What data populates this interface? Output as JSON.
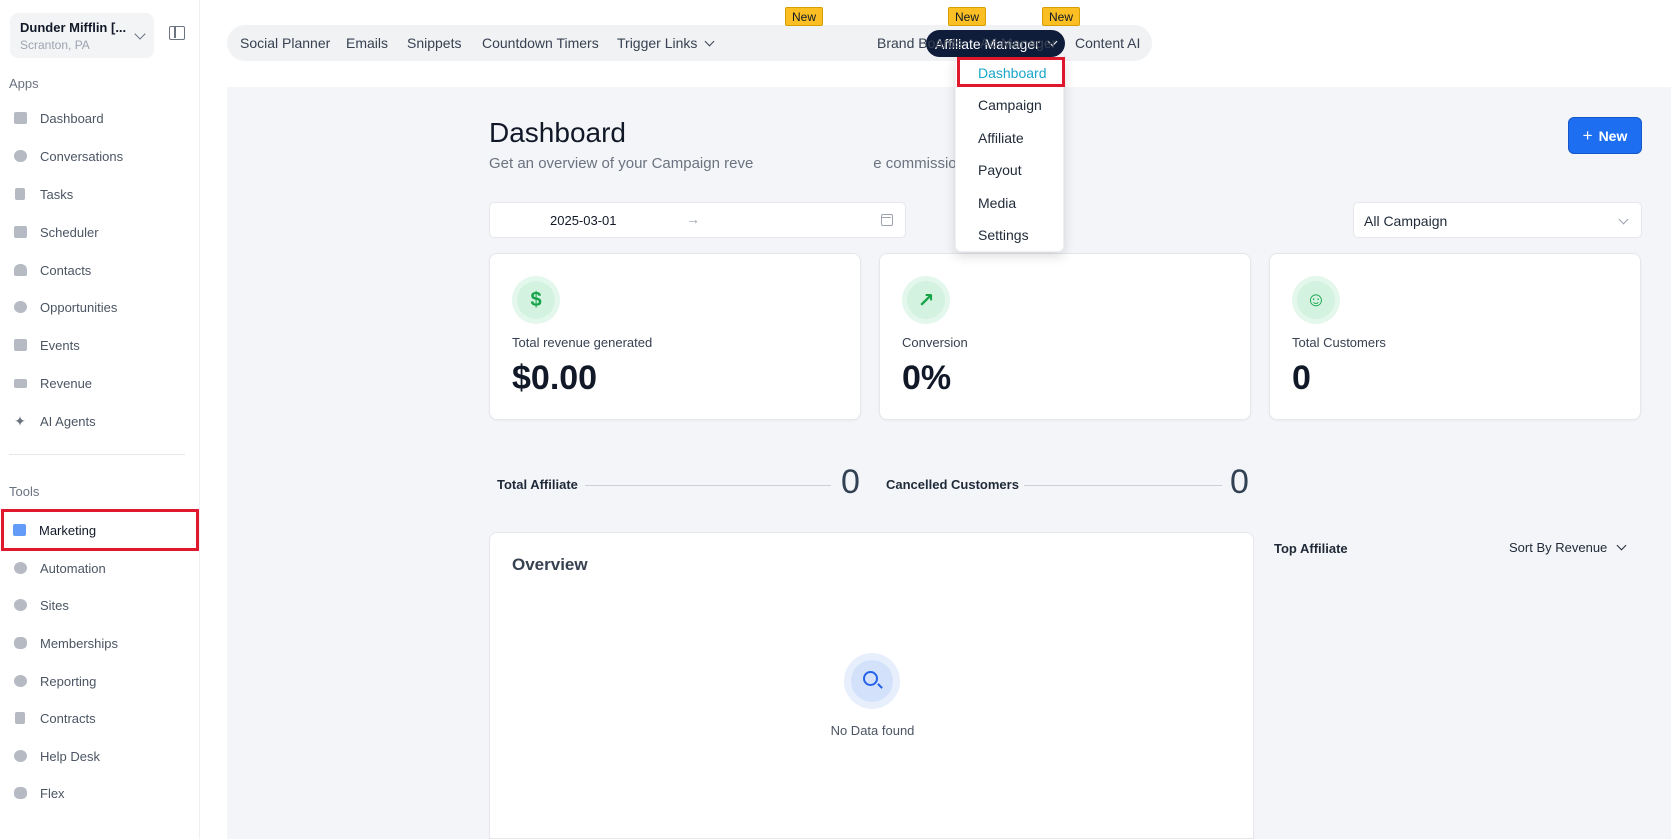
{
  "sidebar": {
    "location_name": "Dunder Mifflin [...",
    "location_sub": "Scranton, PA",
    "apps_label": "Apps",
    "tools_label": "Tools",
    "apps": [
      {
        "label": "Dashboard",
        "icon": "dashboard-icon"
      },
      {
        "label": "Conversations",
        "icon": "chat-icon"
      },
      {
        "label": "Tasks",
        "icon": "tasks-icon"
      },
      {
        "label": "Scheduler",
        "icon": "calendar-icon"
      },
      {
        "label": "Contacts",
        "icon": "person-icon"
      },
      {
        "label": "Opportunities",
        "icon": "target-icon"
      },
      {
        "label": "Events",
        "icon": "events-icon"
      },
      {
        "label": "Revenue",
        "icon": "card-icon"
      },
      {
        "label": "AI Agents",
        "icon": "sparkles-icon"
      }
    ],
    "tools": [
      {
        "label": "Marketing",
        "icon": "megaphone-icon"
      },
      {
        "label": "Automation",
        "icon": "gears-icon"
      },
      {
        "label": "Sites",
        "icon": "globe-icon"
      },
      {
        "label": "Memberships",
        "icon": "group-icon"
      },
      {
        "label": "Reporting",
        "icon": "pie-icon"
      },
      {
        "label": "Contracts",
        "icon": "document-icon"
      },
      {
        "label": "Help Desk",
        "icon": "help-icon"
      },
      {
        "label": "Flex",
        "icon": "people-icon"
      }
    ]
  },
  "topnav": {
    "tabs": [
      "Social Planner",
      "Emails",
      "Snippets",
      "Countdown Timers",
      "Trigger Links",
      "Affiliate Manager",
      "Brand Boards",
      "Ad Manager",
      "Content AI"
    ],
    "badge": "New"
  },
  "dropdown": [
    "Dashboard",
    "Campaign",
    "Affiliate",
    "Payout",
    "Media",
    "Settings"
  ],
  "page": {
    "title": "Dashboard",
    "subtitle_start": "Get an overview of your Campaign reve",
    "subtitle_end": "e commissions",
    "new_button": "New",
    "date_start": "2025-03-01",
    "campaign_select": "All Campaign"
  },
  "stats": [
    {
      "label": "Total revenue generated",
      "value": "$0.00",
      "icon_glyph": "$",
      "icon": "dollar-icon"
    },
    {
      "label": "Conversion",
      "value": "0%",
      "icon_glyph": "↗",
      "icon": "trend-up-icon"
    },
    {
      "label": "Total Customers",
      "value": "0",
      "icon_glyph": "☺",
      "icon": "customers-icon"
    }
  ],
  "metrics": [
    {
      "label": "Total Affiliate",
      "value": "0"
    },
    {
      "label": "Cancelled Customers",
      "value": "0"
    }
  ],
  "overview": {
    "title": "Overview",
    "empty": "No Data found"
  },
  "top_affiliate": {
    "title": "Top Affiliate",
    "sort": "Sort By Revenue"
  },
  "colors": {
    "accent": "#1d6ef0",
    "active_tab": "#0f1d3a",
    "badge": "#fbbf24",
    "highlight": "#e0182d"
  }
}
